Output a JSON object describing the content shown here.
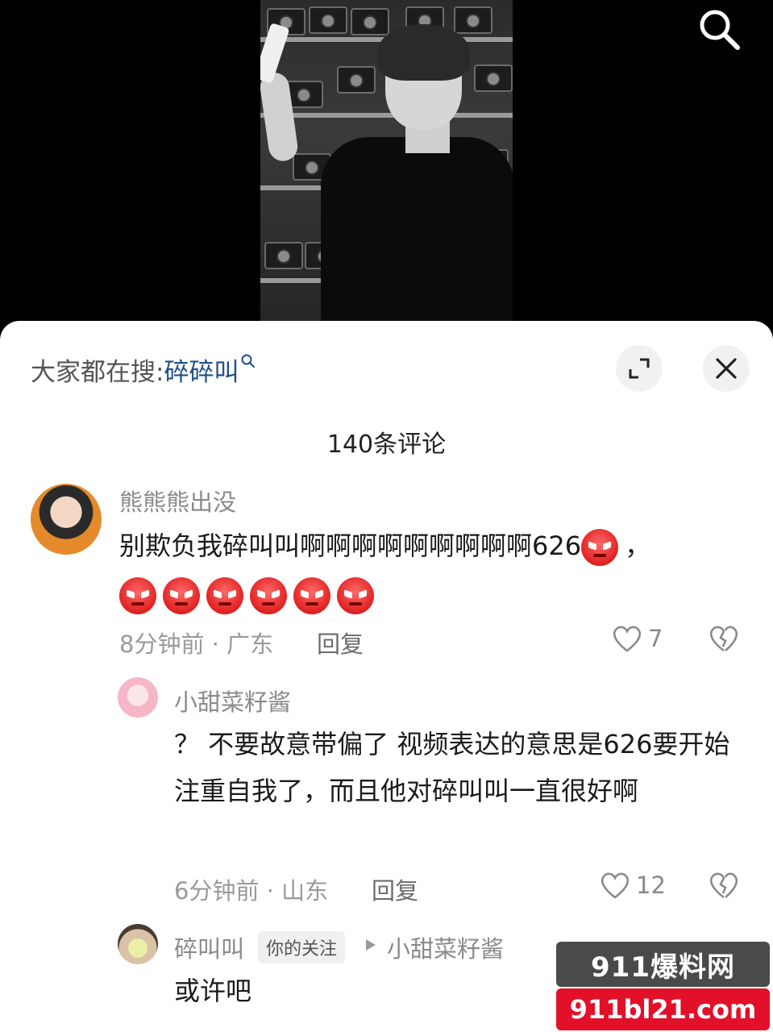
{
  "hot_search": {
    "prefix": "大家都在搜:",
    "keyword": "碎碎叫"
  },
  "comment_count": "140条评论",
  "comments": [
    {
      "username": "熊熊熊出没",
      "text_line1": "别欺负我碎叫叫啊啊啊啊啊啊啊啊啊626",
      "text_line1_suffix": "，",
      "angry_emoji_count": 7,
      "meta": "8分钟前 · 广东",
      "reply_label": "回复",
      "likes": "7"
    },
    {
      "username": "小甜菜籽酱",
      "text": "？ 不要故意带偏了 视频表达的意思是626要开始注重自我了，而且他对碎叫叫一直很好啊",
      "meta": "6分钟前 · 山东",
      "reply_label": "回复",
      "likes": "12"
    },
    {
      "username": "碎叫叫",
      "badge": "你的关注",
      "reply_to": "小甜菜籽酱",
      "text": "或许吧"
    }
  ],
  "watermark": {
    "top": "911爆料网",
    "bottom": "911bl21.com"
  },
  "colors": {
    "keyword": "#1f4e8c",
    "watermark_red": "#e3102a"
  }
}
